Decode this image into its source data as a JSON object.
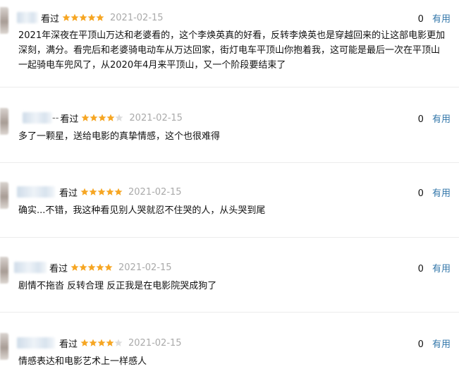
{
  "comments": [
    {
      "dash": "",
      "watched": "看过",
      "rating": 5,
      "date": "2021-02-15",
      "votes": "0",
      "useful_label": "有用",
      "text": "2021年深夜在平顶山万达和老婆看的，这个李焕英真的好看，反转李焕英也是穿越回来的让这部电影更加深刻，满分。看完后和老婆骑电动车从万达回家，街灯电车平顶山你抱着我，这可能是最后一次在平顶山一起骑电车兜风了，从2020年4月来平顶山，又一个阶段要结束了"
    },
    {
      "dash": "--",
      "watched": "看过",
      "rating": 4,
      "date": "2021-02-15",
      "votes": "0",
      "useful_label": "有用",
      "text": "多了一颗星，送给电影的真挚情感，这个也很难得"
    },
    {
      "dash": "",
      "watched": "看过",
      "rating": 5,
      "date": "2021-02-15",
      "votes": "0",
      "useful_label": "有用",
      "text": "确实...不错，我这种看见别人哭就忍不住哭的人，从头哭到尾"
    },
    {
      "dash": "",
      "watched": "看过",
      "rating": 5,
      "date": "2021-02-15",
      "votes": "0",
      "useful_label": "有用",
      "text": "剧情不拖沓 反转合理 反正我是在电影院哭成狗了"
    },
    {
      "dash": "",
      "watched": "看过",
      "rating": 4,
      "date": "2021-02-15",
      "votes": "0",
      "useful_label": "有用",
      "text": "情感表达和电影艺术上一样感人"
    }
  ],
  "colors": {
    "star_filled": "#f6a623",
    "star_empty": "#dddddd",
    "useful_link": "#3377aa",
    "date": "#aaaaaa",
    "divider": "#ececec"
  },
  "icons": {
    "star": "star-icon"
  }
}
